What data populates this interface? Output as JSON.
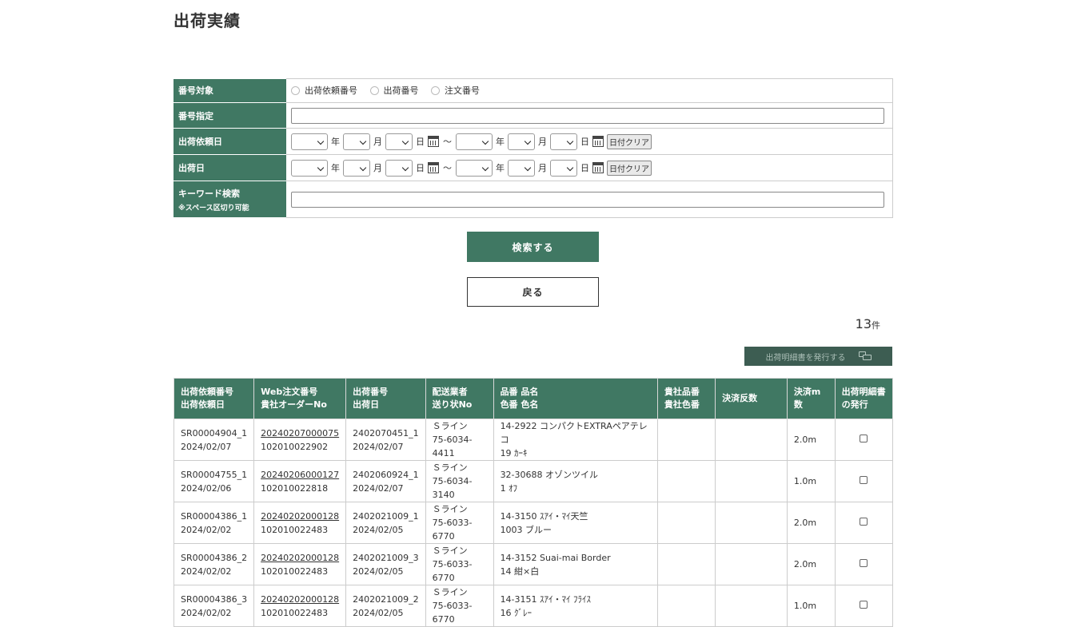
{
  "page": {
    "title": "出荷実績"
  },
  "form": {
    "number_target": {
      "label": "番号対象",
      "options": [
        "出荷依頼番号",
        "出荷番号",
        "注文番号"
      ]
    },
    "number_spec": {
      "label": "番号指定",
      "value": ""
    },
    "request_date": {
      "label": "出荷依頼日"
    },
    "ship_date": {
      "label": "出荷日"
    },
    "date_units": {
      "year": "年",
      "month": "月",
      "day": "日",
      "tilde": "～",
      "clear": "日付クリア"
    },
    "keyword": {
      "label": "キーワード検索",
      "note": "※スペース区切り可能",
      "value": ""
    }
  },
  "buttons": {
    "search": "検索する",
    "back": "戻る",
    "issue": "出荷明細書を発行する"
  },
  "result_count": {
    "number": "13",
    "unit": "件"
  },
  "table": {
    "headers": [
      [
        "出荷依頼番号",
        "出荷依頼日"
      ],
      [
        "Web注文番号",
        "貴社オーダーNo"
      ],
      [
        "出荷番号",
        "出荷日"
      ],
      [
        "配送業者",
        "送り状No"
      ],
      [
        "品番 品名",
        "色番 色名"
      ],
      [
        "貴社品番",
        "貴社色番"
      ],
      [
        "決済反数",
        ""
      ],
      [
        "決済m数",
        ""
      ],
      [
        "出荷明細書",
        "の発行"
      ]
    ],
    "rows": [
      {
        "req_no": "SR00004904_1",
        "req_date": "2024/02/07",
        "web_no": "20240207000075",
        "order_no": "102010022902",
        "ship_no": "2402070451_1",
        "ship_date": "2024/02/07",
        "carrier": "Ｓライン",
        "slip": "75-6034-4411",
        "item": "14-2922 コンパクトEXTRAペアテレコ",
        "color": "19 ｶｰｷ",
        "cust_item": "",
        "cust_color": "",
        "rolls": "",
        "meters": "2.0m"
      },
      {
        "req_no": "SR00004755_1",
        "req_date": "2024/02/06",
        "web_no": "20240206000127",
        "order_no": "102010022818",
        "ship_no": "2402060924_1",
        "ship_date": "2024/02/07",
        "carrier": "Ｓライン",
        "slip": "75-6034-3140",
        "item": "32-30688 オゾンツイル",
        "color": "1 ｵﾌ",
        "cust_item": "",
        "cust_color": "",
        "rolls": "",
        "meters": "1.0m"
      },
      {
        "req_no": "SR00004386_1",
        "req_date": "2024/02/02",
        "web_no": "20240202000128",
        "order_no": "102010022483",
        "ship_no": "2402021009_1",
        "ship_date": "2024/02/05",
        "carrier": "Ｓライン",
        "slip": "75-6033-6770",
        "item": "14-3150 ｽｱｲ・ﾏｲ天竺",
        "color": "1003 ブルー",
        "cust_item": "",
        "cust_color": "",
        "rolls": "",
        "meters": "2.0m"
      },
      {
        "req_no": "SR00004386_2",
        "req_date": "2024/02/02",
        "web_no": "20240202000128",
        "order_no": "102010022483",
        "ship_no": "2402021009_3",
        "ship_date": "2024/02/05",
        "carrier": "Ｓライン",
        "slip": "75-6033-6770",
        "item": "14-3152 Suai-mai Border",
        "color": "14 紺×白",
        "cust_item": "",
        "cust_color": "",
        "rolls": "",
        "meters": "2.0m"
      },
      {
        "req_no": "SR00004386_3",
        "req_date": "2024/02/02",
        "web_no": "20240202000128",
        "order_no": "102010022483",
        "ship_no": "2402021009_2",
        "ship_date": "2024/02/05",
        "carrier": "Ｓライン",
        "slip": "75-6033-6770",
        "item": "14-3151 ｽｱｲ・ﾏｲ ﾌﾗｲｽ",
        "color": "16 ｸﾞﾚｰ",
        "cust_item": "",
        "cust_color": "",
        "rolls": "",
        "meters": "1.0m"
      }
    ]
  }
}
